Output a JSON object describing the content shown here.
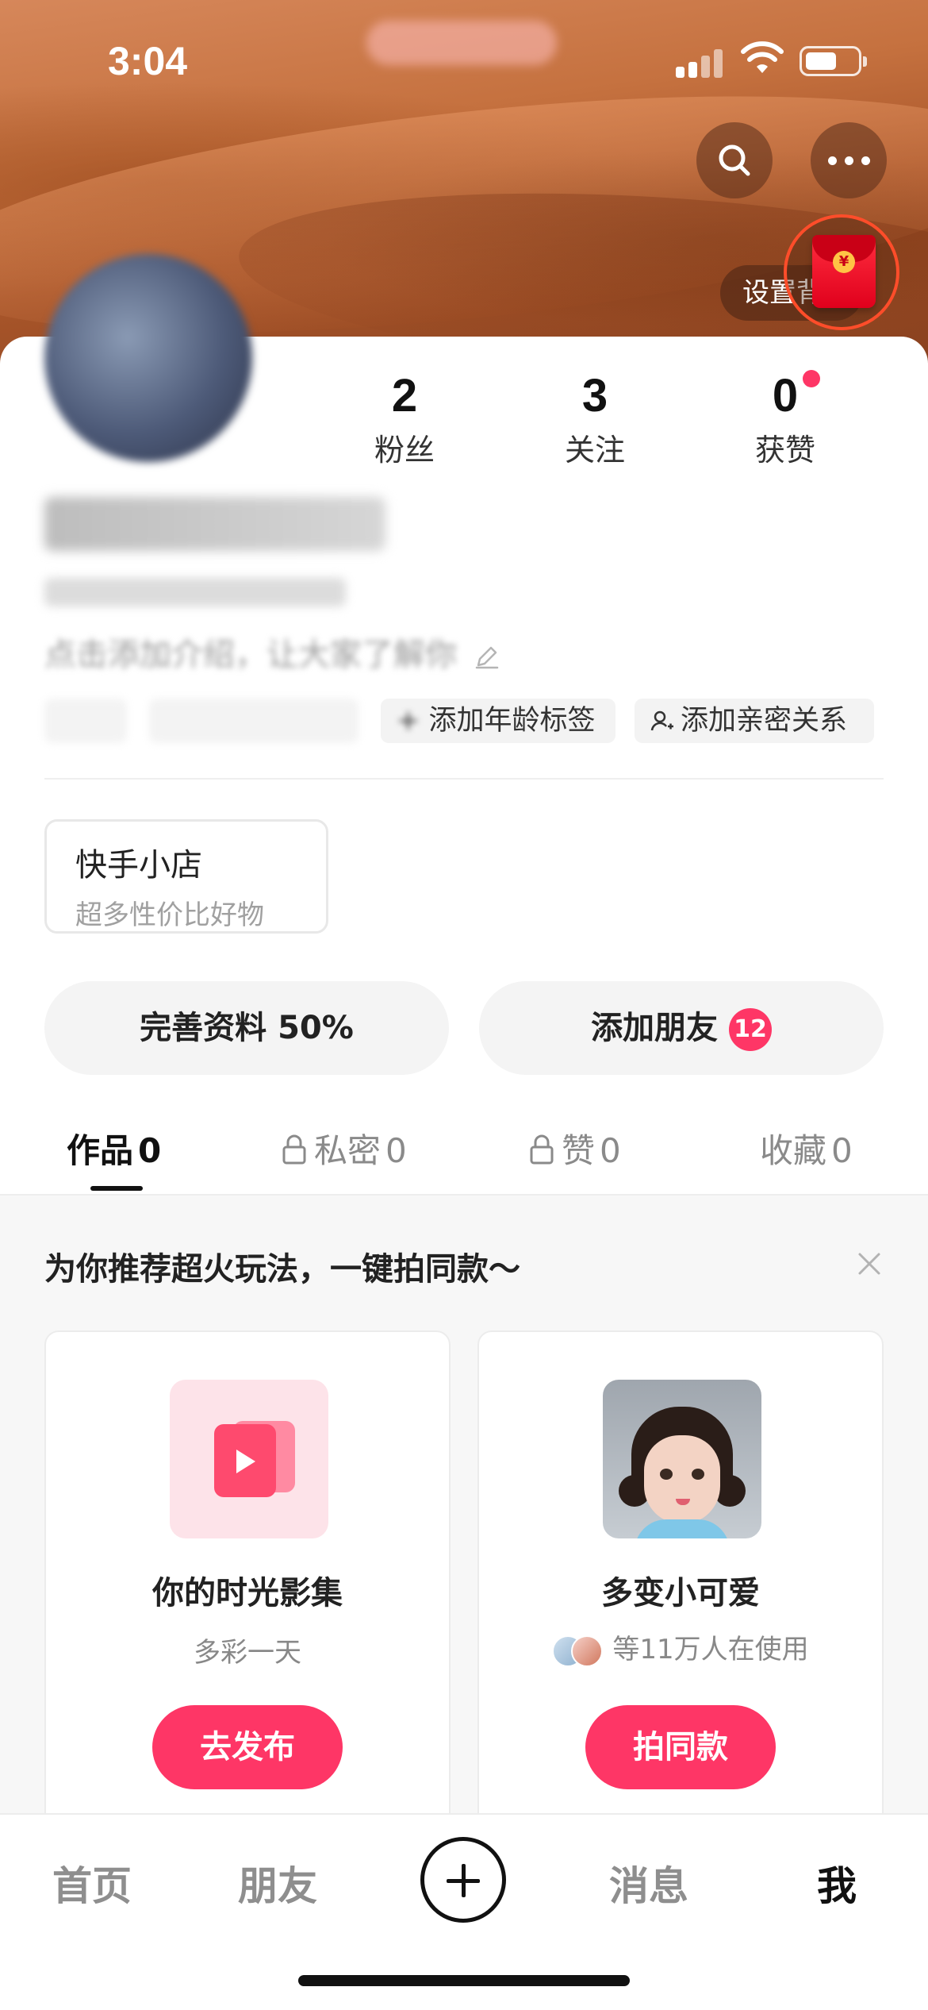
{
  "status_bar": {
    "time": "3:04"
  },
  "header": {
    "bg_button_label": "设置背",
    "icons": [
      "search-icon",
      "more-icon",
      "red-packet-icon"
    ]
  },
  "profile": {
    "stats": [
      {
        "value": "2",
        "label": "粉丝"
      },
      {
        "value": "3",
        "label": "关注"
      },
      {
        "value": "0",
        "label": "获赞"
      }
    ],
    "name": "",
    "bio_placeholder": "点击添加介绍，让大家了解你",
    "tags": [
      {
        "label": ""
      },
      {
        "label": ""
      },
      {
        "label": "添加年龄标签"
      },
      {
        "label": "添加亲密关系"
      }
    ]
  },
  "shop": {
    "title": "快手小店",
    "subtitle": "超多性价比好物"
  },
  "actions": {
    "complete_profile": "完善资料 50%",
    "add_friends": "添加朋友",
    "add_friends_badge": "12"
  },
  "tabs": [
    {
      "label": "作品",
      "count": "0"
    },
    {
      "label": "私密",
      "count": "0"
    },
    {
      "label": "赞",
      "count": "0"
    },
    {
      "label": "收藏",
      "count": "0"
    }
  ],
  "recommend": {
    "title": "为你推荐超火玩法，一键拍同款～",
    "cards": [
      {
        "name": "你的时光影集",
        "subtitle": "多彩一天",
        "button": "去发布"
      },
      {
        "name": "多变小可爱",
        "users_text": "等11万人在使用",
        "button": "拍同款"
      }
    ]
  },
  "bottom_nav": {
    "home": "首页",
    "friends": "朋友",
    "messages": "消息",
    "me": "我"
  },
  "colors": {
    "accent": "#fe3666",
    "badge": "#fe3666"
  }
}
